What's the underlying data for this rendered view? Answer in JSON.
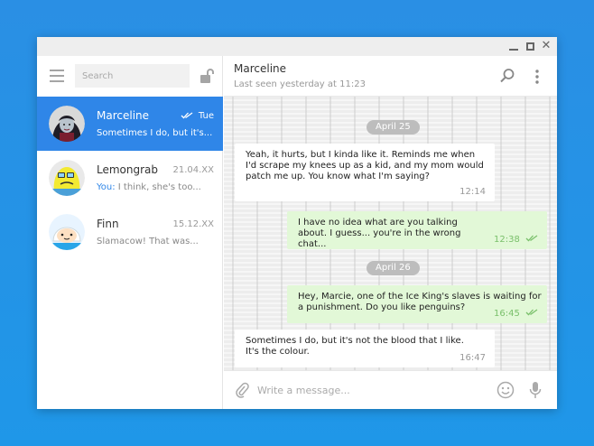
{
  "window": {
    "controls": [
      "minimize-icon",
      "maximize-icon",
      "close-icon"
    ]
  },
  "sidebar": {
    "search_placeholder": "Search",
    "chats": [
      {
        "name": "Marceline",
        "date": "Tue",
        "preview": "Sometimes I do, but it's...",
        "you_prefix": "",
        "active": true,
        "read": true
      },
      {
        "name": "Lemongrab",
        "date": "21.04.XX",
        "you_prefix": "You:",
        "preview": " I think, she's too...",
        "active": false
      },
      {
        "name": "Finn",
        "date": "15.12.XX",
        "you_prefix": "",
        "preview": "Slamacow! That was...",
        "active": false
      }
    ]
  },
  "header": {
    "name": "Marceline",
    "status": "Last seen yesterday at 11:23"
  },
  "messages": {
    "dates": [
      "April 25",
      "April 26"
    ],
    "items": [
      {
        "dir": "in",
        "text": "Yeah, it hurts, but I kinda like it. Reminds me when I'd scrape my knees up as a kid, and my mom would patch me up. You know what I'm saying?",
        "time": "12:14"
      },
      {
        "dir": "out",
        "text": "I have no idea what are you talking about. I guess... you're in the wrong chat...",
        "time": "12:38"
      },
      {
        "dir": "out",
        "text": "Hey, Marcie, one of the Ice King's slaves is waiting for a punishment. Do you like penguins?",
        "time": "16:45"
      },
      {
        "dir": "in",
        "text": "Sometimes I do, but it's not the blood that I like. It's the colour.",
        "time": "16:47"
      }
    ]
  },
  "composer": {
    "placeholder": "Write a message..."
  },
  "colors": {
    "accent": "#2f86e8",
    "outgoing": "#e2f8d7",
    "background": "#1f97e8"
  }
}
